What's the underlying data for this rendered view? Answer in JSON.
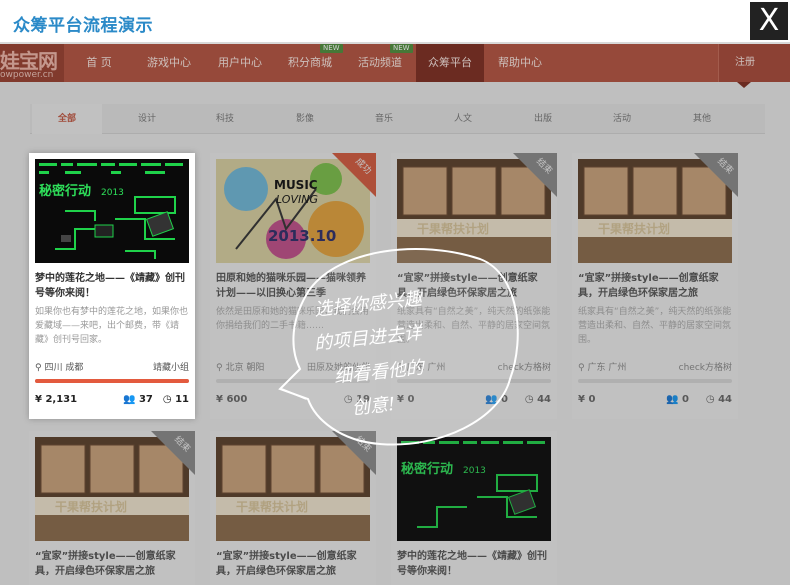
{
  "window": {
    "title": "众筹平台流程演示",
    "close_label": "X"
  },
  "site": {
    "logo_text": "娃宝网",
    "logo_sub": "owpower.cn",
    "nav": [
      {
        "label": "首 页"
      },
      {
        "label": "游戏中心"
      },
      {
        "label": "用户中心"
      },
      {
        "label": "积分商城",
        "badge": "NEW"
      },
      {
        "label": "活动频道",
        "badge": "NEW"
      },
      {
        "label": "众筹平台",
        "active": true
      },
      {
        "label": "帮助中心"
      }
    ],
    "nav_right": "注册"
  },
  "categories": [
    "全部",
    "设计",
    "科技",
    "影像",
    "音乐",
    "人文",
    "出版",
    "活动",
    "其他"
  ],
  "active_category": "全部",
  "tip_lines": [
    "选择你感兴趣",
    "的项目进去详",
    "细看看他的",
    "创意!"
  ],
  "cards": [
    {
      "title": "梦中的莲花之地——《靖藏》创刊号等你来阅！",
      "desc": "如果你也有梦中的莲花之地，如果你也爱藏域——来吧，出个邮费，带《靖藏》创刊号回家。",
      "location": "四川 成都",
      "group": "靖藏小组",
      "progress": 0.95,
      "money": "2,131",
      "backers": "37",
      "days": "11",
      "ribbon": ""
    },
    {
      "title": "田原和她的猫咪乐园——猫咪领养计划——以旧换心第三季",
      "desc": "依然是田原和她的猫咪乐园，我们会用你捐给我们的二手书籍……",
      "location": "北京 朝阳",
      "group": "田原及她的伙伴",
      "progress": 0.0,
      "money": "600",
      "backers": "",
      "days": "19",
      "ribbon": "成功"
    },
    {
      "title": "“宜家”拼接style——创意纸家具，开启绿色环保家居之旅",
      "desc": "纸家具有“自然之美”，纯天然的纸张能营造出柔和、自然、平静的居家空间氛围。",
      "location": "广东 广州",
      "group": "check方格树",
      "progress": 0.0,
      "money": "0",
      "backers": "0",
      "days": "44",
      "ribbon": "结束"
    },
    {
      "title": "“宜家”拼接style——创意纸家具，开启绿色环保家居之旅",
      "desc": "纸家具有“自然之美”，纯天然的纸张能营造出柔和、自然、平静的居家空间氛围。",
      "location": "广东 广州",
      "group": "check方格树",
      "progress": 0.0,
      "money": "0",
      "backers": "0",
      "days": "44",
      "ribbon": "结束"
    },
    {
      "title": "“宜家”拼接style——创意纸家具，开启绿色环保家居之旅",
      "ribbon": "结束"
    },
    {
      "title": "“宜家”拼接style——创意纸家具，开启绿色环保家居之旅",
      "ribbon": "结束"
    },
    {
      "title": "梦中的莲花之地——《靖藏》创刊号等你来阅！",
      "ribbon": ""
    }
  ],
  "image_text": {
    "game_title": "秘密行动",
    "game_year": "2013",
    "music_title": "MUSIC",
    "music_sub": "LOVING",
    "music_date": "2013.10",
    "paper_banner": "干果帮扶计划"
  },
  "colors": {
    "accent": "#2b8ac8",
    "nav": "#b5533f",
    "progress": "#e35a3e"
  }
}
